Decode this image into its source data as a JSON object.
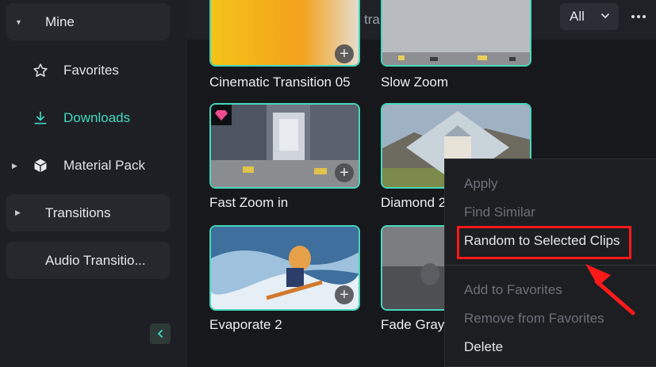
{
  "sidebar": {
    "mine_label": "Mine",
    "favorites_label": "Favorites",
    "downloads_label": "Downloads",
    "material_pack_label": "Material Pack",
    "transitions_label": "Transitions",
    "audio_transitions_label": "Audio Transitio...",
    "accent_color": "#3fd9c1"
  },
  "search": {
    "placeholder": "Search downloaded transitions",
    "filter_value": "All"
  },
  "cards": [
    {
      "title": "Cinematic Transition 05"
    },
    {
      "title": "Slow Zoom"
    },
    {
      "title": "Fast Zoom in"
    },
    {
      "title": "Diamond 2"
    },
    {
      "title": "Evaporate 2"
    },
    {
      "title": "Fade Gray"
    }
  ],
  "context_menu": {
    "apply": "Apply",
    "find_similar": "Find Similar",
    "random_selected": "Random to Selected Clips",
    "add_favorites": "Add to Favorites",
    "remove_favorites": "Remove from Favorites",
    "delete": "Delete"
  },
  "colors": {
    "thumb_border": "#47d6bb",
    "highlight": "#ff1a1a"
  }
}
